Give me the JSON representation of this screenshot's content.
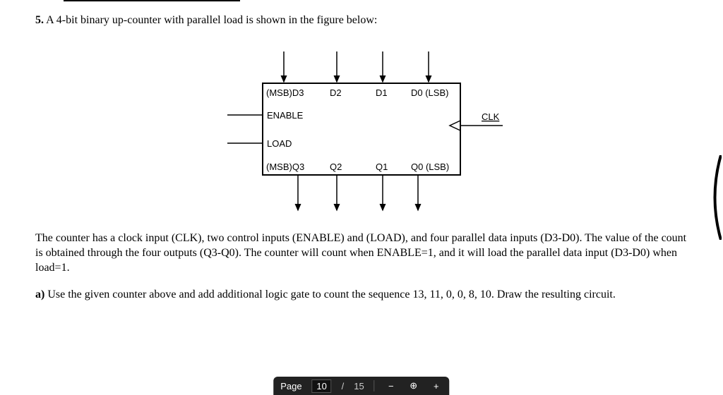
{
  "question": {
    "number": "5.",
    "intro": "A 4-bit binary up-counter with parallel load is shown in the figure below:"
  },
  "diagram": {
    "top_inputs": {
      "d3": "(MSB)D3",
      "d2": "D2",
      "d1": "D1",
      "d0": "D0 (LSB)"
    },
    "left_inputs": {
      "enable": "ENABLE",
      "load": "LOAD"
    },
    "right_input": {
      "clk": "CLK"
    },
    "bottom_outputs": {
      "q3": "(MSB)Q3",
      "q2": "Q2",
      "q1": "Q1",
      "q0": "Q0 (LSB)"
    }
  },
  "description": "The counter has a clock input (CLK), two control inputs (ENABLE) and (LOAD), and four parallel data inputs (D3-D0). The value of the count is obtained through the four outputs (Q3-Q0). The counter will count when ENABLE=1, and it will load the parallel data input (D3-D0) when load=1.",
  "part_a": {
    "label": "a)",
    "text": "Use the given counter above and add additional logic gate to count the sequence 13, 11, 0, 0, 8, 10.  Draw the resulting circuit."
  },
  "toolbar": {
    "page_label_prefix": "Page",
    "current_page": "10",
    "slash": "/",
    "total_pages": "15",
    "zoom_out": "−",
    "zoom_in": "+",
    "zoom_reset_icon": "⊕"
  }
}
